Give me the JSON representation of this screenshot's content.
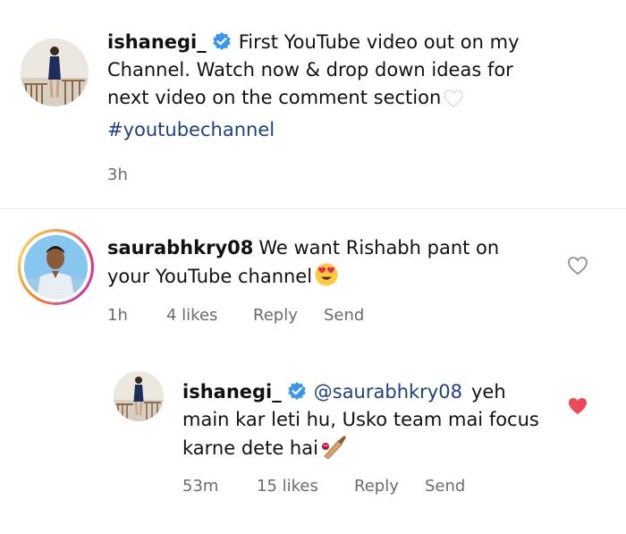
{
  "post": {
    "username": "ishanegi_",
    "caption": "First YouTube video out on my Channel. Watch now & drop down ideas for next video on the comment section",
    "hashtag": "#youtubechannel",
    "time": "3h"
  },
  "comment": {
    "username": "saurabhkry08",
    "text": "We want Rishabh pant on your YouTube channel",
    "time": "1h",
    "likes": "4 likes",
    "reply_label": "Reply",
    "send_label": "Send",
    "liked": false
  },
  "reply": {
    "username": "ishanegi_",
    "mention": "@saurabhkry08",
    "text": "yeh main kar leti hu, Usko team mai focus karne dete hai",
    "time": "53m",
    "likes": "15 likes",
    "reply_label": "Reply",
    "send_label": "Send",
    "liked": true
  },
  "colors": {
    "link": "#1e3f8a",
    "verified": "#3897f0",
    "liked_heart": "#ed4956",
    "meta_text": "#6b6b6b"
  },
  "icons": [
    "verified-badge-icon",
    "white-heart-emoji",
    "heart-eyes-emoji",
    "cricket-bat-emoji",
    "heart-outline-icon",
    "heart-filled-icon"
  ]
}
